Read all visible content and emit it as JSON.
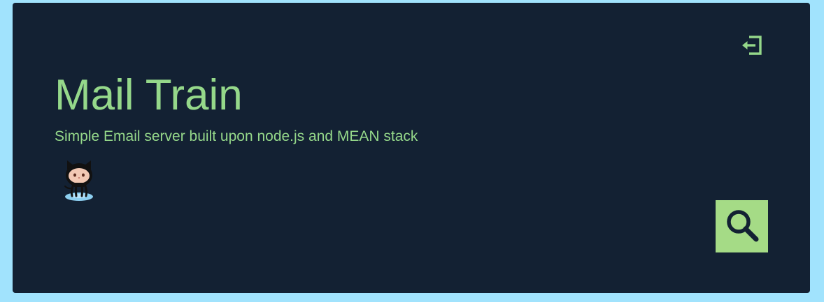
{
  "header": {
    "title": "Mail Train",
    "subtitle": "Simple Email server built upon node.js and MEAN stack"
  },
  "icons": {
    "logout": "logout-icon",
    "github": "github-octocat-icon",
    "search": "search-icon"
  },
  "colors": {
    "page_background": "#a1e3fd",
    "card_background": "#132133",
    "accent_text": "#95d88a",
    "search_button": "#a5db86"
  }
}
